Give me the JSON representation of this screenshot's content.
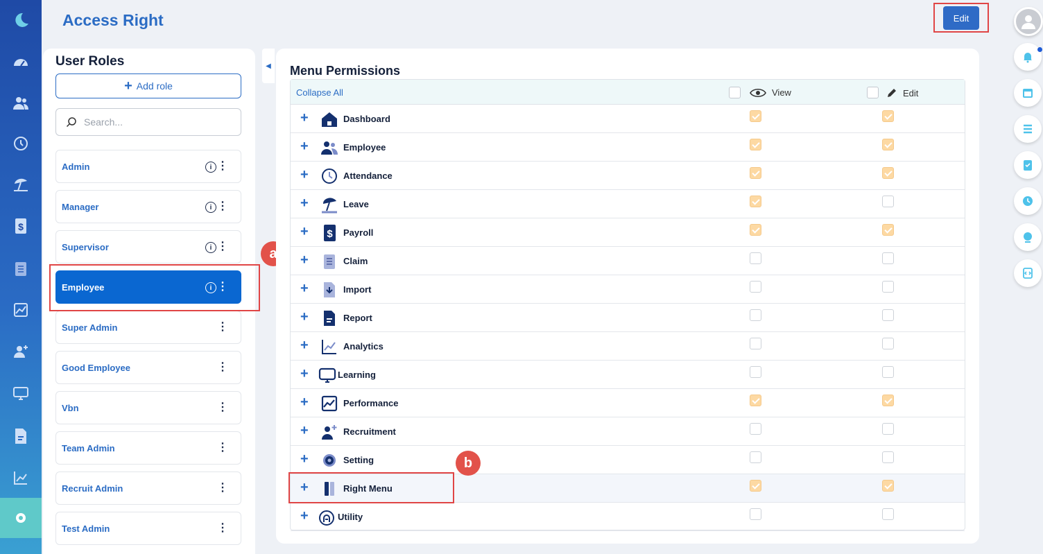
{
  "page": {
    "title": "Access Right",
    "edit_label": "Edit"
  },
  "roles": {
    "title": "User Roles",
    "add_label": "Add role",
    "search_placeholder": "Search...",
    "items": [
      {
        "label": "Admin",
        "info": true,
        "active": false
      },
      {
        "label": "Manager",
        "info": true,
        "active": false
      },
      {
        "label": "Supervisor",
        "info": true,
        "active": false
      },
      {
        "label": "Employee",
        "info": true,
        "active": true
      },
      {
        "label": "Super Admin",
        "info": false,
        "active": false
      },
      {
        "label": "Good Employee",
        "info": false,
        "active": false
      },
      {
        "label": "Vbn",
        "info": false,
        "active": false
      },
      {
        "label": "Team Admin",
        "info": false,
        "active": false
      },
      {
        "label": "Recruit Admin",
        "info": false,
        "active": false
      },
      {
        "label": "Test Admin",
        "info": false,
        "active": false
      }
    ]
  },
  "permissions": {
    "title": "Menu Permissions",
    "collapse_all": "Collapse All",
    "col_view": "View",
    "col_edit": "Edit",
    "rows": [
      {
        "label": "Dashboard",
        "icon": "home-icon",
        "view": true,
        "edit": true
      },
      {
        "label": "Employee",
        "icon": "users-icon",
        "view": true,
        "edit": true
      },
      {
        "label": "Attendance",
        "icon": "history-clock-icon",
        "view": true,
        "edit": true
      },
      {
        "label": "Leave",
        "icon": "beach-umbrella-icon",
        "view": true,
        "edit": false
      },
      {
        "label": "Payroll",
        "icon": "dollar-doc-icon",
        "view": true,
        "edit": true
      },
      {
        "label": "Claim",
        "icon": "clipboard-icon",
        "view": false,
        "edit": false
      },
      {
        "label": "Import",
        "icon": "import-icon",
        "view": false,
        "edit": false
      },
      {
        "label": "Report",
        "icon": "report-icon",
        "view": false,
        "edit": false
      },
      {
        "label": "Analytics",
        "icon": "line-chart-icon",
        "view": false,
        "edit": false
      },
      {
        "label": "Learning",
        "icon": "monitor-icon",
        "view": false,
        "edit": false
      },
      {
        "label": "Performance",
        "icon": "performance-chart-icon",
        "view": true,
        "edit": true
      },
      {
        "label": "Recruitment",
        "icon": "add-user-icon",
        "view": false,
        "edit": false
      },
      {
        "label": "Setting",
        "icon": "gear-icon",
        "view": false,
        "edit": false
      },
      {
        "label": "Right Menu",
        "icon": "right-menu-icon",
        "view": true,
        "edit": true
      },
      {
        "label": "Utility",
        "icon": "utility-icon",
        "view": false,
        "edit": false
      }
    ]
  },
  "annotations": {
    "a": "a",
    "b": "b"
  },
  "colors": {
    "accent": "#2b6cc4",
    "active_role": "#0a67d1",
    "checked": "#fdd9a3",
    "highlight": "#e04545"
  }
}
